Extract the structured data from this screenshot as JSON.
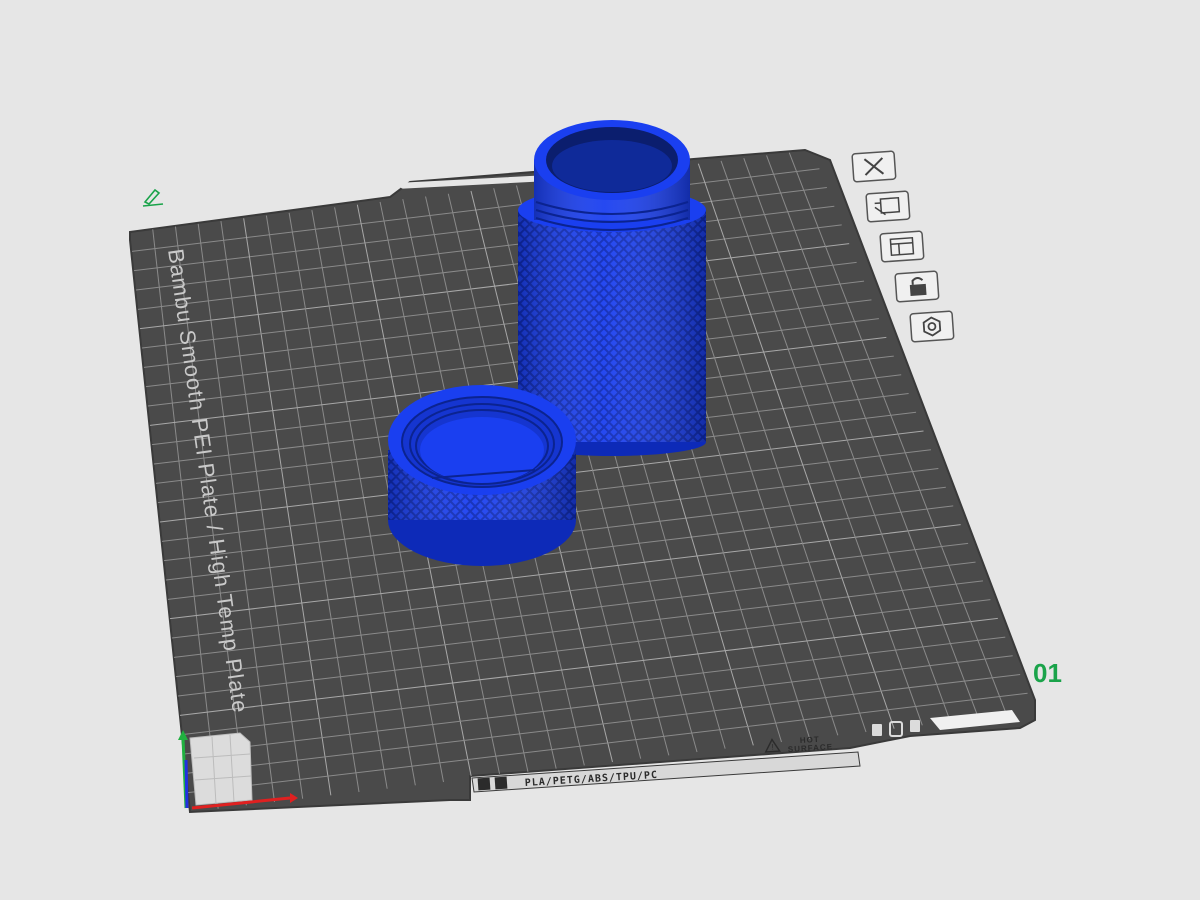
{
  "plate": {
    "label": "Bambu Smooth PEI Plate / High Temp Plate",
    "number": "01",
    "material_strip": "PLA/PETG/ABS/TPU/PC",
    "hot_surface_line1": "HOT",
    "hot_surface_line2": "SURFACE"
  },
  "plate_tools": [
    {
      "name": "delete-plate",
      "icon": "close-icon"
    },
    {
      "name": "auto-arrange",
      "icon": "arrange-icon"
    },
    {
      "name": "plate-settings",
      "icon": "settings-panel-icon"
    },
    {
      "name": "lock-plate",
      "icon": "lock-icon"
    },
    {
      "name": "plate-gear",
      "icon": "hex-gear-icon"
    }
  ],
  "colors": {
    "background": "#e6e6e6",
    "plate": "#4a4a4a",
    "grid": "#8a8a8a",
    "model": "#1a3ff0",
    "accent_green": "#1aa34a",
    "axis_x": "#e02020",
    "axis_y": "#20b040",
    "axis_z": "#2030e0"
  }
}
